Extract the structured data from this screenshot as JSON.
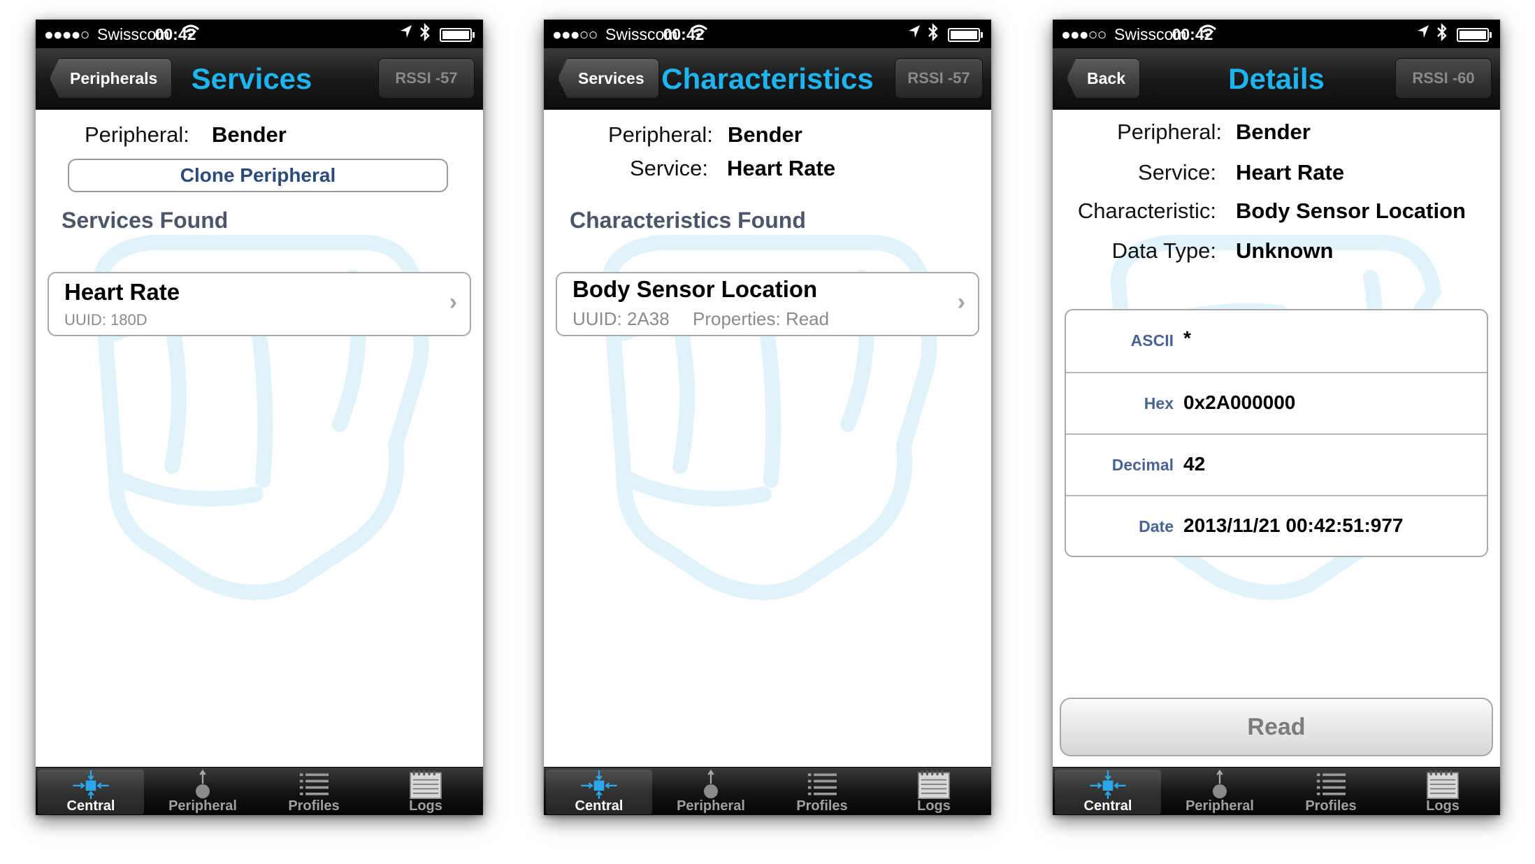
{
  "status": {
    "signal_4": "●●●●○",
    "signal_3": "●●●○○",
    "carrier": "Swisscom",
    "time": "00:42"
  },
  "tabs": [
    "Central",
    "Peripheral",
    "Profiles",
    "Logs"
  ],
  "screens": [
    {
      "nav": {
        "back": "Peripherals",
        "title": "Services",
        "rssi": "RSSI -57"
      },
      "peripheral_label": "Peripheral:",
      "peripheral_value": "Bender",
      "clone_button": "Clone Peripheral",
      "section_title": "Services Found",
      "items": [
        {
          "title": "Heart Rate",
          "uuid": "UUID: 180D"
        }
      ]
    },
    {
      "nav": {
        "back": "Services",
        "title": "Characteristics",
        "rssi": "RSSI -57"
      },
      "peripheral_label": "Peripheral:",
      "peripheral_value": "Bender",
      "service_label": "Service:",
      "service_value": "Heart Rate",
      "section_title": "Characteristics Found",
      "items": [
        {
          "title": "Body Sensor Location",
          "uuid": "UUID: 2A38",
          "properties": "Properties: Read"
        }
      ]
    },
    {
      "nav": {
        "back": "Back",
        "title": "Details",
        "rssi": "RSSI -60"
      },
      "fields": [
        {
          "label": "Peripheral:",
          "value": "Bender"
        },
        {
          "label": "Service:",
          "value": "Heart Rate"
        },
        {
          "label": "Characteristic:",
          "value": "Body Sensor Location"
        },
        {
          "label": "Data Type:",
          "value": "Unknown"
        }
      ],
      "rows": [
        {
          "label": "ASCII",
          "value": "*"
        },
        {
          "label": "Hex",
          "value": "0x2A000000"
        },
        {
          "label": "Decimal",
          "value": "42"
        },
        {
          "label": "Date",
          "value": "2013/11/21 00:42:51:977"
        }
      ],
      "read_button": "Read"
    }
  ],
  "colors": {
    "title_blue": "#1eb4ef",
    "label_blue": "#4a6393",
    "section_gray": "#4c566a",
    "icon_blue": "#2aa7e8"
  }
}
